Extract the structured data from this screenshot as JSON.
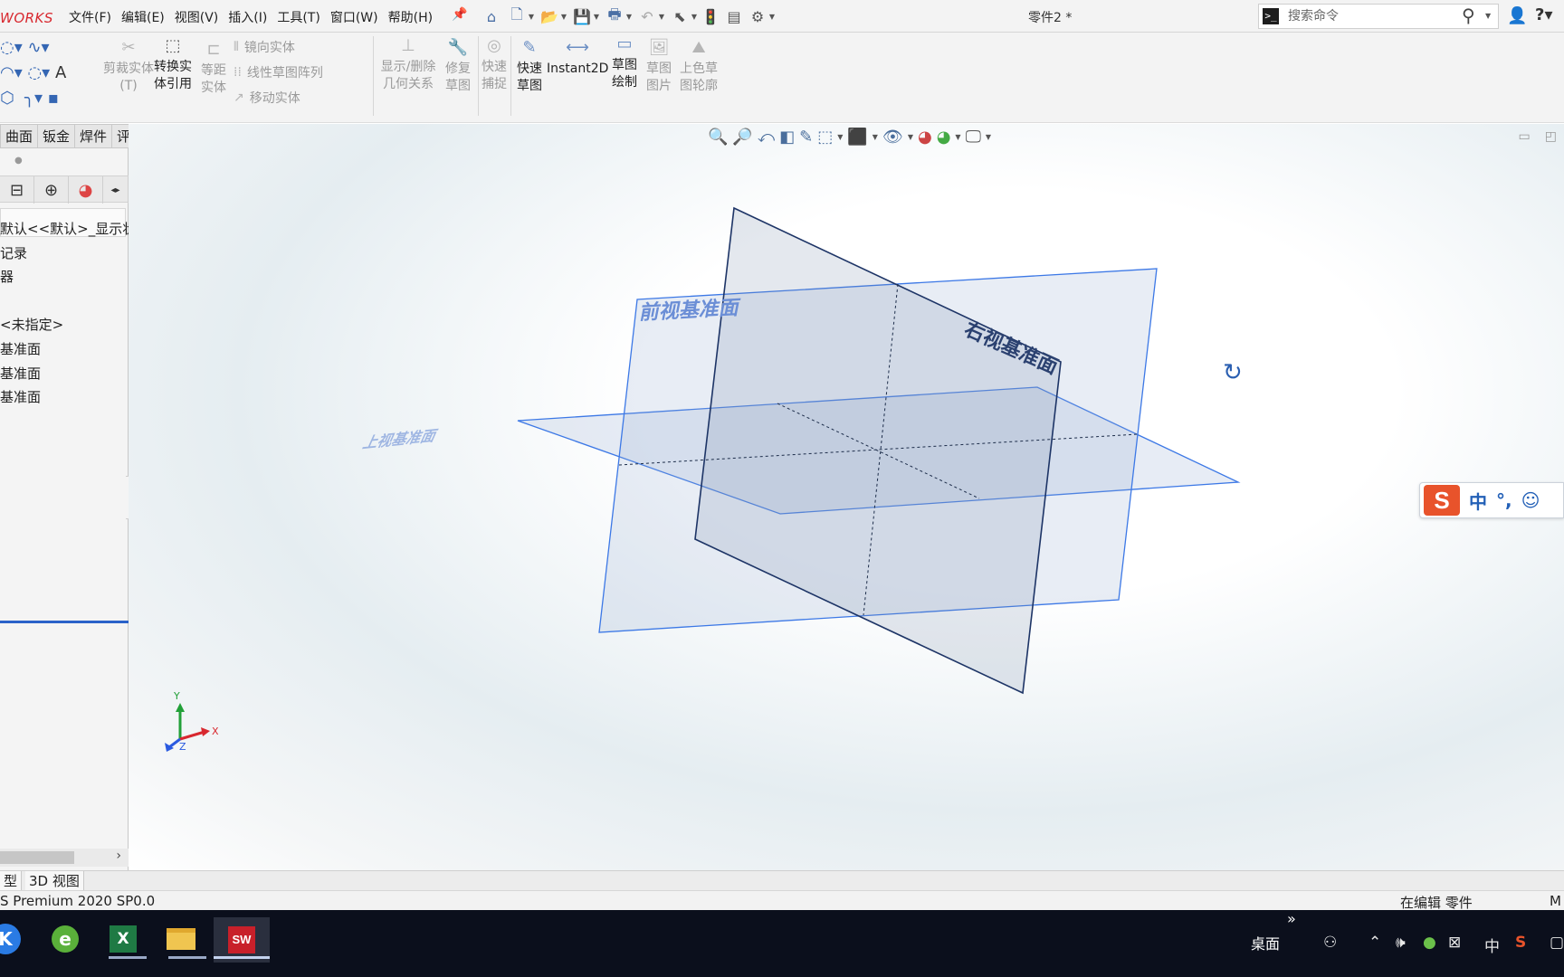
{
  "app": {
    "logo_text": "WORKS",
    "doc_title": "零件2 *",
    "brand_color": "#d8282f",
    "accent_color": "#2a62c9"
  },
  "menu": [
    "文件(F)",
    "编辑(E)",
    "视图(V)",
    "插入(I)",
    "工具(T)",
    "窗口(W)",
    "帮助(H)"
  ],
  "quick_access_icons": [
    "home-icon",
    "new-document-icon",
    "open-icon",
    "save-icon",
    "print-icon",
    "undo-icon",
    "select-icon",
    "rebuild-icon",
    "file-properties-icon",
    "options-icon"
  ],
  "search": {
    "placeholder": "搜索命令"
  },
  "ribbon": {
    "trim": "剪裁实体(T)",
    "convert_1": "转换实",
    "convert_2": "体引用",
    "offset_1": "等距",
    "offset_2": "实体",
    "mirror": "镜向实体",
    "linear_pattern": "线性草图阵列",
    "move": "移动实体",
    "relations_1": "显示/删除",
    "relations_2": "几何关系",
    "repair_1": "修复",
    "repair_2": "草图",
    "snap_1": "快速",
    "snap_2": "捕捉",
    "quick_sketch_1": "快速",
    "quick_sketch_2": "草图",
    "instant2d": "Instant2D",
    "sketch_draw_1": "草图",
    "sketch_draw_2": "绘制",
    "sketch_picture_1": "草图",
    "sketch_picture_2": "图片",
    "shaded_contour_1": "上色草",
    "shaded_contour_2": "图轮廓"
  },
  "tabs": [
    "曲面",
    "钣金",
    "焊件",
    "评估"
  ],
  "feature_tree": [
    "默认<<默认>_显示状",
    "记录",
    "器",
    "<未指定>",
    "基准面",
    "基准面",
    "基准面"
  ],
  "viewport": {
    "planes": {
      "front": "前视基准面",
      "right": "右视基准面",
      "top": "上视基准面"
    },
    "triad": {
      "x": "X",
      "y": "Y",
      "z": "Z"
    }
  },
  "ime": {
    "mode": "中",
    "punct": "°,",
    "emoji": "☺"
  },
  "bottom_tabs": [
    "型",
    "3D 视图"
  ],
  "status": {
    "version": "S Premium 2020 SP0.0",
    "state": "在编辑 零件",
    "units": "M"
  },
  "taskbar": {
    "desktop": "桌面",
    "more": "»",
    "ime_mode": "中",
    "apps": [
      "app-k-icon",
      "browser-icon",
      "excel-icon",
      "file-explorer-icon",
      "solidworks-icon"
    ]
  }
}
